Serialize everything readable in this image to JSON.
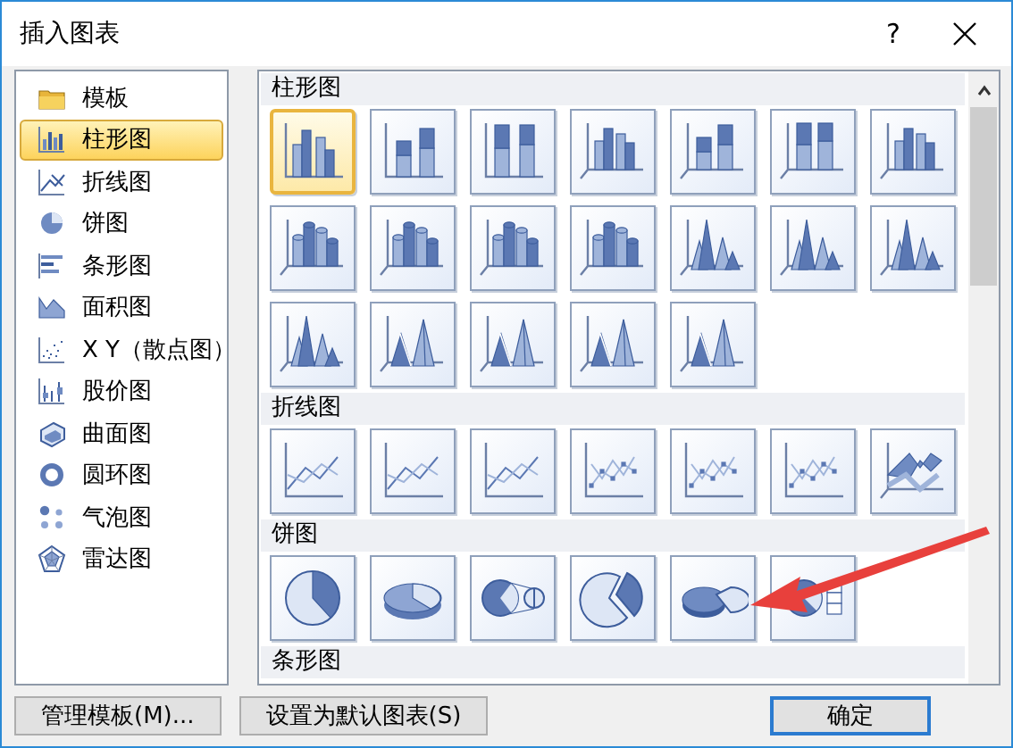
{
  "window": {
    "title": "插入图表",
    "help": "?"
  },
  "sidebar": {
    "items": [
      {
        "label": "模板",
        "kind": "folder",
        "selected": false
      },
      {
        "label": "柱形图",
        "kind": "column",
        "selected": true
      },
      {
        "label": "折线图",
        "kind": "line",
        "selected": false
      },
      {
        "label": "饼图",
        "kind": "pie",
        "selected": false
      },
      {
        "label": "条形图",
        "kind": "bar",
        "selected": false
      },
      {
        "label": "面积图",
        "kind": "area",
        "selected": false
      },
      {
        "label": "X Y（散点图）",
        "kind": "scatter",
        "selected": false
      },
      {
        "label": "股价图",
        "kind": "stock",
        "selected": false
      },
      {
        "label": "曲面图",
        "kind": "surface",
        "selected": false
      },
      {
        "label": "圆环图",
        "kind": "doughnut",
        "selected": false
      },
      {
        "label": "气泡图",
        "kind": "bubble",
        "selected": false
      },
      {
        "label": "雷达图",
        "kind": "radar",
        "selected": false
      }
    ]
  },
  "gallery": {
    "sections": [
      {
        "title": "柱形图",
        "items": [
          {
            "kind": "column",
            "selected": true
          },
          {
            "kind": "column-stacked",
            "selected": false
          },
          {
            "kind": "column-percent",
            "selected": false
          },
          {
            "kind": "column-3d",
            "selected": false
          },
          {
            "kind": "column-3d-stacked",
            "selected": false
          },
          {
            "kind": "column-3d-percent",
            "selected": false
          },
          {
            "kind": "column-3d",
            "selected": false
          },
          {
            "kind": "cylinder",
            "selected": false
          },
          {
            "kind": "cylinder",
            "selected": false
          },
          {
            "kind": "cylinder",
            "selected": false
          },
          {
            "kind": "cylinder",
            "selected": false
          },
          {
            "kind": "cone",
            "selected": false
          },
          {
            "kind": "cone",
            "selected": false
          },
          {
            "kind": "cone",
            "selected": false
          },
          {
            "kind": "cone",
            "selected": false
          },
          {
            "kind": "pyramid",
            "selected": false
          },
          {
            "kind": "pyramid",
            "selected": false
          },
          {
            "kind": "pyramid",
            "selected": false
          },
          {
            "kind": "pyramid",
            "selected": false
          }
        ]
      },
      {
        "title": "折线图",
        "items": [
          {
            "kind": "line",
            "selected": false
          },
          {
            "kind": "line",
            "selected": false
          },
          {
            "kind": "line",
            "selected": false
          },
          {
            "kind": "line-markers",
            "selected": false
          },
          {
            "kind": "line-markers",
            "selected": false
          },
          {
            "kind": "line-markers",
            "selected": false
          },
          {
            "kind": "line-3d",
            "selected": false
          }
        ]
      },
      {
        "title": "饼图",
        "items": [
          {
            "kind": "pie",
            "selected": false
          },
          {
            "kind": "pie-3d",
            "selected": false
          },
          {
            "kind": "pie-of-pie",
            "selected": false
          },
          {
            "kind": "pie-exploded",
            "selected": false
          },
          {
            "kind": "pie-3d-exploded",
            "selected": false
          },
          {
            "kind": "bar-of-pie",
            "selected": false
          }
        ]
      },
      {
        "title": "条形图"
      }
    ]
  },
  "annotations": [
    {
      "kind": "arrow"
    }
  ],
  "buttons": [
    {
      "label": "管理模板(M)...",
      "kind": "secondary"
    },
    {
      "label": "设置为默认图表(S)",
      "kind": "secondary"
    },
    {
      "label": "确定",
      "kind": "default"
    }
  ]
}
